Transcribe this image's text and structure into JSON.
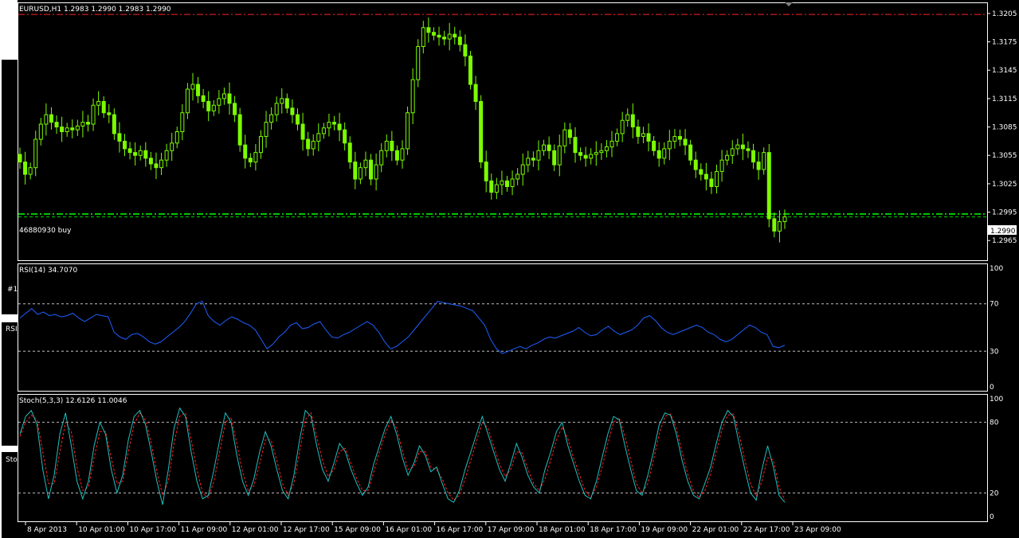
{
  "window": {
    "symbol_info": "EURUSD,H1  1.2983 1.2990 1.2983 1.2990",
    "order_label": "46880930 buy",
    "price_tag": "1.2990"
  },
  "side_fragments": {
    "rsi_tab": "RSI",
    "sto_tab": "Sto",
    "marker": "#1"
  },
  "colors": {
    "background": "#000000",
    "candles": "#7CFC00",
    "max_line": "#ff2020",
    "order_line": "#00cc00",
    "rsi_line": "#1e5eff",
    "stoch_main": "#20c0c0",
    "stoch_signal": "#ff2020",
    "panel_border": "#ffffff"
  },
  "chart_data": [
    {
      "type": "candlestick",
      "title": "EURUSD,H1",
      "ylim": [
        1.2945,
        1.3215
      ],
      "y_ticks": [
        "1.3205",
        "1.3175",
        "1.3145",
        "1.3115",
        "1.3085",
        "1.3055",
        "1.3025",
        "1.2995",
        "1.2965"
      ],
      "close": [
        1.3048,
        1.3035,
        1.3042,
        1.3072,
        1.3088,
        1.3098,
        1.309,
        1.3085,
        1.308,
        1.3084,
        1.3082,
        1.3086,
        1.309,
        1.3088,
        1.3108,
        1.3112,
        1.31,
        1.3098,
        1.3078,
        1.307,
        1.3062,
        1.3058,
        1.3055,
        1.306,
        1.3052,
        1.3046,
        1.3042,
        1.305,
        1.306,
        1.3068,
        1.308,
        1.31,
        1.3125,
        1.313,
        1.3118,
        1.3112,
        1.3102,
        1.3108,
        1.3115,
        1.312,
        1.311,
        1.3098,
        1.3066,
        1.3052,
        1.3048,
        1.3058,
        1.3075,
        1.309,
        1.3098,
        1.311,
        1.3115,
        1.3105,
        1.3098,
        1.3088,
        1.3072,
        1.3062,
        1.307,
        1.3078,
        1.3084,
        1.309,
        1.3088,
        1.3082,
        1.3068,
        1.3048,
        1.303,
        1.3042,
        1.305,
        1.303,
        1.3045,
        1.306,
        1.307,
        1.306,
        1.305,
        1.3062,
        1.31,
        1.3135,
        1.317,
        1.319,
        1.3185,
        1.3182,
        1.318,
        1.3178,
        1.3183,
        1.318,
        1.3172,
        1.316,
        1.313,
        1.3112,
        1.3048,
        1.3028,
        1.3016,
        1.3024,
        1.3028,
        1.3022,
        1.303,
        1.3035,
        1.3045,
        1.3052,
        1.305,
        1.306,
        1.3066,
        1.306,
        1.3045,
        1.3065,
        1.3082,
        1.3074,
        1.3058,
        1.3055,
        1.3052,
        1.3056,
        1.3058,
        1.306,
        1.3064,
        1.307,
        1.3078,
        1.3092,
        1.3098,
        1.3085,
        1.3075,
        1.3078,
        1.307,
        1.306,
        1.3052,
        1.3062,
        1.307,
        1.3075,
        1.3072,
        1.3066,
        1.305,
        1.304,
        1.3035,
        1.303,
        1.3022,
        1.3038,
        1.305,
        1.3055,
        1.3062,
        1.3066,
        1.3062,
        1.306,
        1.3048,
        1.304,
        1.3058,
        1.2988,
        1.2975,
        1.2985,
        1.299
      ],
      "levels": {
        "max_dashdot": 1.3204,
        "order_buy": 1.2993,
        "bid": 1.299
      }
    },
    {
      "type": "line",
      "title": "RSI(14) 34.7070",
      "ylim": [
        0,
        100
      ],
      "y_ticks": [
        "100",
        "70",
        "30",
        "0"
      ],
      "levels": [
        70,
        30
      ],
      "series": [
        {
          "name": "RSI(14)",
          "values": [
            58,
            62,
            66,
            61,
            63,
            60,
            61,
            59,
            60,
            62,
            58,
            55,
            58,
            61,
            60,
            59,
            46,
            42,
            40,
            44,
            45,
            42,
            38,
            36,
            38,
            42,
            46,
            50,
            55,
            62,
            70,
            72,
            60,
            55,
            52,
            56,
            59,
            57,
            54,
            52,
            48,
            40,
            32,
            36,
            42,
            46,
            52,
            54,
            49,
            50,
            53,
            55,
            48,
            42,
            41,
            44,
            46,
            49,
            52,
            55,
            52,
            46,
            38,
            32,
            34,
            38,
            42,
            48,
            54,
            60,
            66,
            72,
            71,
            70,
            69,
            68,
            66,
            64,
            58,
            52,
            40,
            32,
            28,
            30,
            32,
            34,
            32,
            35,
            37,
            40,
            42,
            41,
            43,
            45,
            47,
            50,
            46,
            43,
            44,
            48,
            51,
            47,
            44,
            46,
            48,
            52,
            58,
            60,
            56,
            50,
            46,
            44,
            46,
            48,
            50,
            52,
            50,
            46,
            44,
            40,
            38,
            40,
            44,
            48,
            52,
            50,
            46,
            44,
            34,
            33,
            35
          ]
        }
      ]
    },
    {
      "type": "line",
      "title": "Stoch(5,3,3) 12.6126 11.0046",
      "ylim": [
        0,
        100
      ],
      "y_ticks": [
        "100",
        "80",
        "20",
        "0"
      ],
      "levels": [
        80,
        20
      ],
      "x_ticks": [
        "8 Apr 2013",
        "10 Apr 01:00",
        "10 Apr 17:00",
        "11 Apr 09:00",
        "12 Apr 01:00",
        "12 Apr 17:00",
        "15 Apr 09:00",
        "16 Apr 01:00",
        "16 Apr 17:00",
        "17 Apr 09:00",
        "18 Apr 01:00",
        "18 Apr 17:00",
        "19 Apr 09:00",
        "22 Apr 01:00",
        "22 Apr 17:00",
        "23 Apr 09:00"
      ],
      "series": [
        {
          "name": "Stoch main",
          "values": [
            70,
            85,
            90,
            78,
            40,
            15,
            35,
            70,
            88,
            60,
            30,
            15,
            30,
            60,
            80,
            70,
            40,
            20,
            35,
            65,
            85,
            90,
            78,
            55,
            30,
            10,
            40,
            75,
            92,
            85,
            55,
            30,
            15,
            18,
            40,
            65,
            88,
            80,
            52,
            30,
            18,
            32,
            55,
            72,
            60,
            40,
            22,
            15,
            35,
            65,
            90,
            85,
            60,
            40,
            30,
            45,
            62,
            55,
            40,
            28,
            18,
            25,
            45,
            60,
            75,
            85,
            70,
            50,
            35,
            45,
            60,
            52,
            38,
            42,
            28,
            15,
            12,
            22,
            40,
            55,
            70,
            85,
            70,
            55,
            40,
            30,
            45,
            62,
            50,
            35,
            25,
            20,
            40,
            55,
            72,
            80,
            60,
            45,
            30,
            18,
            15,
            30,
            50,
            70,
            85,
            82,
            60,
            40,
            22,
            18,
            35,
            55,
            78,
            88,
            86,
            70,
            48,
            30,
            18,
            15,
            28,
            42,
            62,
            80,
            90,
            85,
            62,
            40,
            20,
            14,
            40,
            60,
            42,
            18,
            12
          ]
        },
        {
          "name": "Stoch signal",
          "values": [
            68,
            80,
            86,
            82,
            55,
            28,
            28,
            55,
            80,
            72,
            42,
            22,
            25,
            50,
            72,
            72,
            50,
            28,
            30,
            55,
            78,
            88,
            82,
            62,
            38,
            18,
            30,
            62,
            85,
            88,
            65,
            40,
            20,
            16,
            30,
            55,
            80,
            84,
            62,
            38,
            22,
            26,
            45,
            65,
            65,
            48,
            28,
            18,
            28,
            55,
            82,
            88,
            68,
            48,
            34,
            40,
            55,
            58,
            45,
            32,
            22,
            22,
            38,
            55,
            70,
            82,
            75,
            56,
            40,
            42,
            55,
            55,
            42,
            40,
            32,
            20,
            14,
            18,
            32,
            48,
            64,
            80,
            75,
            60,
            45,
            34,
            40,
            55,
            54,
            40,
            28,
            22,
            32,
            48,
            65,
            76,
            66,
            50,
            36,
            22,
            16,
            25,
            42,
            62,
            80,
            84,
            68,
            48,
            28,
            20,
            28,
            48,
            70,
            85,
            87,
            75,
            55,
            36,
            22,
            16,
            22,
            36,
            55,
            74,
            86,
            87,
            70,
            48,
            28,
            17,
            30,
            50,
            48,
            25,
            14
          ]
        }
      ]
    }
  ]
}
